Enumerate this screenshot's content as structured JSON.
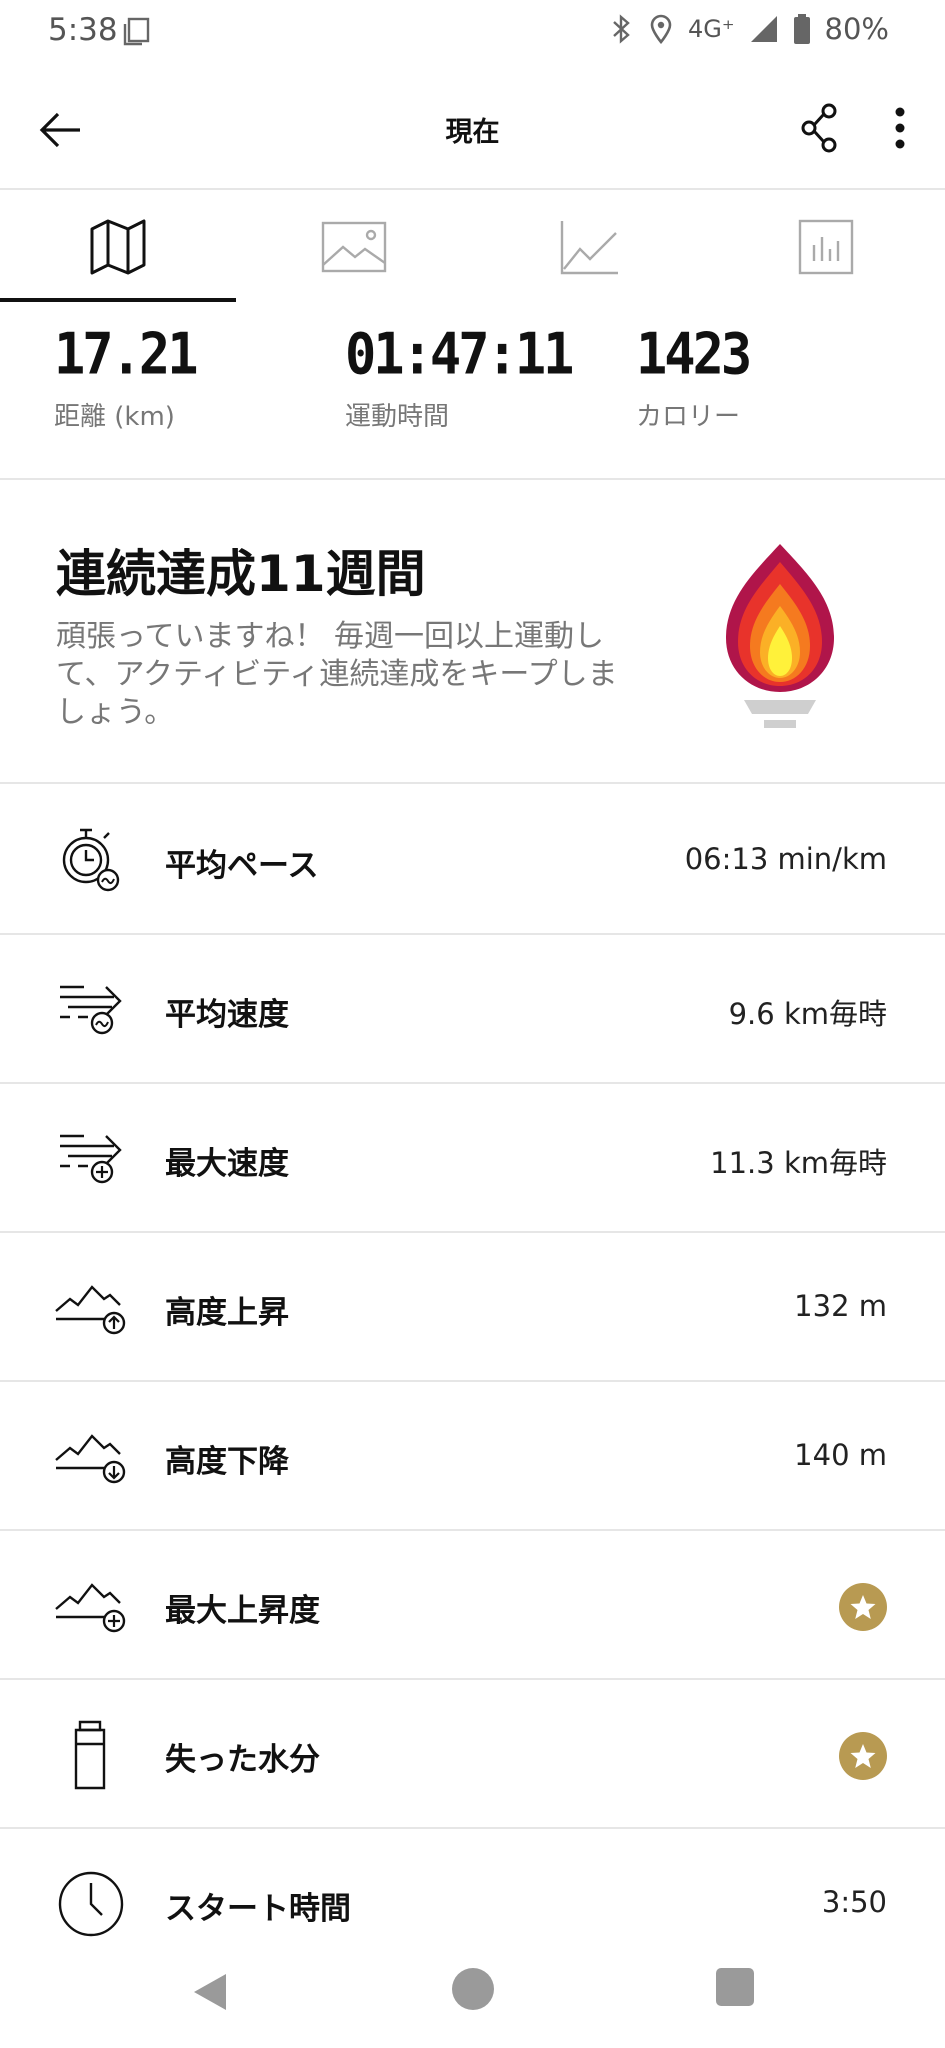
{
  "status_bar": {
    "time": "5:38",
    "network": "4G⁺",
    "battery": "80%"
  },
  "app_bar": {
    "title": "現在"
  },
  "tabs": [
    {
      "name": "map",
      "icon": "map-icon",
      "active": true
    },
    {
      "name": "photos",
      "icon": "image-icon",
      "active": false
    },
    {
      "name": "graph",
      "icon": "line-chart-icon",
      "active": false
    },
    {
      "name": "analysis",
      "icon": "bar-chart-icon",
      "active": false
    }
  ],
  "metrics": [
    {
      "value": "17.21",
      "label": "距離 (km)"
    },
    {
      "value": "01:47:11",
      "label": "運動時間"
    },
    {
      "value": "1423",
      "label": "カロリー"
    }
  ],
  "streak": {
    "title": "連続達成11週間",
    "description": "頑張っていますね！ 毎週一回以上運動して、アクティビティ連続達成をキープしましょう。"
  },
  "stats": [
    {
      "label": "平均ペース",
      "value": "06:13 min/km",
      "icon": "stopwatch-pace-icon"
    },
    {
      "label": "平均速度",
      "value": "9.6 km毎時",
      "icon": "speed-average-icon"
    },
    {
      "label": "最大速度",
      "value": "11.3 km毎時",
      "icon": "speed-max-icon"
    },
    {
      "label": "高度上昇",
      "value": "132 m",
      "icon": "elevation-up-icon"
    },
    {
      "label": "高度下降",
      "value": "140 m",
      "icon": "elevation-down-icon"
    },
    {
      "label": "最大上昇度",
      "value": "",
      "icon": "elevation-max-icon",
      "premium": true
    },
    {
      "label": "失った水分",
      "value": "",
      "icon": "water-bottle-icon",
      "premium": true
    },
    {
      "label": "スタート時間",
      "value": "3:50",
      "icon": "clock-icon"
    }
  ],
  "colors": {
    "accent": "#111111",
    "premium_badge": "#b89a52",
    "divider": "#e6e6e6",
    "secondary_text": "#777777"
  }
}
